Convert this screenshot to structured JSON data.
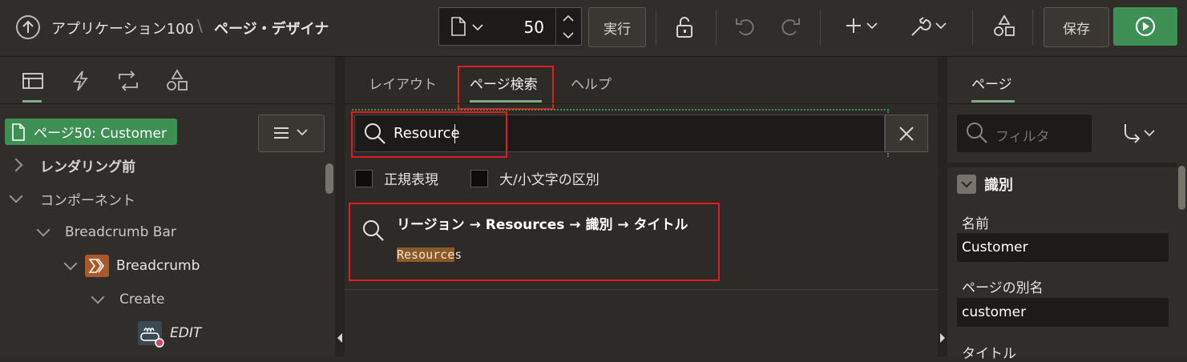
{
  "app": {
    "breadcrumb_app": "アプリケーション100",
    "breadcrumb_sep": "\\",
    "breadcrumb_page": "ページ・デザイナ"
  },
  "toolbar": {
    "page_number": "50",
    "run_label": "実行",
    "save_label": "保存"
  },
  "left": {
    "page_badge": "ページ50: Customer",
    "tree": [
      {
        "label": "レンダリング前"
      },
      {
        "label": "コンポーネント"
      },
      {
        "label": "Breadcrumb Bar"
      },
      {
        "label": "Breadcrumb"
      },
      {
        "label": "Create"
      },
      {
        "label": "EDIT"
      }
    ]
  },
  "middle": {
    "tabs": [
      "レイアウト",
      "ページ検索",
      "ヘルプ"
    ],
    "search_value": "Resource",
    "opt_regex": "正規表現",
    "opt_case": "大/小文字の区別",
    "result_title": "リージョン → Resources → 識別 → タイトル",
    "result_match": "Resource",
    "result_rest": "s"
  },
  "right": {
    "tab": "ページ",
    "filter_placeholder": "フィルタ",
    "section": "識別",
    "name_label": "名前",
    "name_value": "Customer",
    "alias_label": "ページの別名",
    "alias_value": "customer",
    "title_label": "タイトル"
  },
  "colors": {
    "accent_green": "#3d8f54",
    "highlight_red": "#e01e1e",
    "tab_underline": "#7eab83",
    "match_bg": "#8a5a2b"
  }
}
